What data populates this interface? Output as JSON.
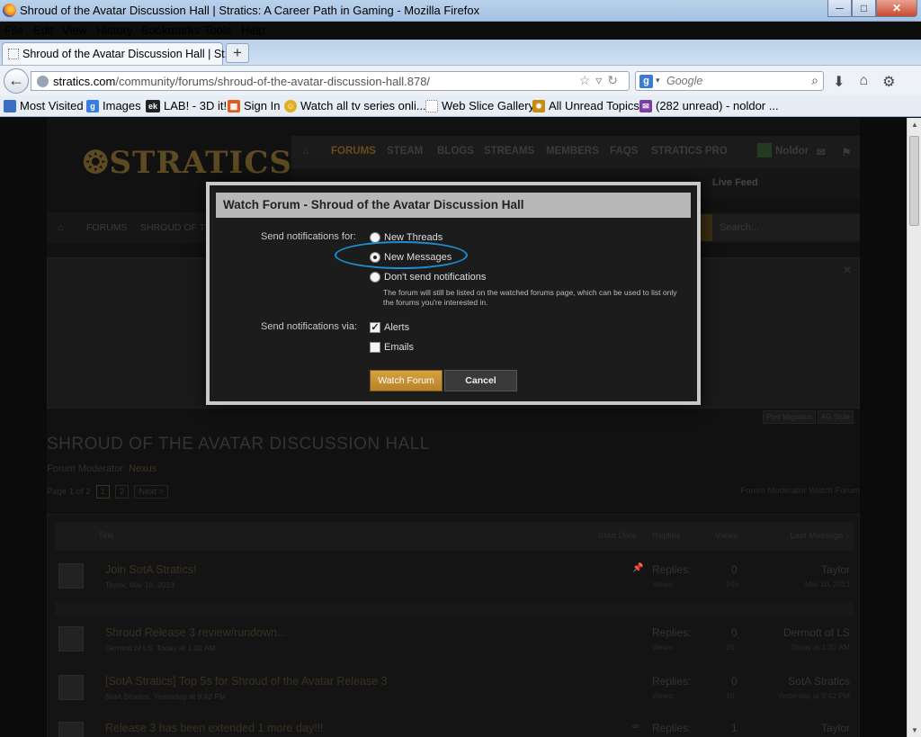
{
  "window": {
    "title": "Shroud of the Avatar Discussion Hall | Stratics: A Career Path in Gaming - Mozilla Firefox",
    "min": "─",
    "max": "□",
    "close": "✕"
  },
  "menu": [
    "File",
    "Edit",
    "View",
    "History",
    "Bookmarks",
    "Tools",
    "Help"
  ],
  "tab": {
    "title": "Shroud of the Avatar Discussion Hall | St...",
    "new_tab": "+"
  },
  "nav": {
    "back": "←",
    "url_host": "stratics.com",
    "url_path": "/community/forums/shroud-of-the-avatar-discussion-hall.878/",
    "url_tools": "☆▿↻",
    "search_placeholder": "Google",
    "search_engine_icon": "g-icon",
    "icons": [
      "⬇",
      "⌂",
      "⚙"
    ]
  },
  "bookmarks": [
    {
      "label": "Most Visited",
      "icon": "M",
      "color": "#3a6fc4"
    },
    {
      "label": "Images",
      "icon": "g",
      "color": "#3a7de0"
    },
    {
      "label": "LAB! - 3D it!",
      "icon": "ek",
      "color": "#222"
    },
    {
      "label": "Sign In",
      "icon": "▦",
      "color": "#e25a1c"
    },
    {
      "label": "Watch all tv series onli...",
      "icon": "☺",
      "color": "#e0b020"
    },
    {
      "label": "Web Slice Gallery",
      "icon": "",
      "color": "#ffffff"
    },
    {
      "label": "All Unread Topics",
      "icon": "✸",
      "color": "#c88a10"
    },
    {
      "label": "(282 unread) - noldor ...",
      "icon": "✉",
      "color": "#7a3fa0"
    }
  ],
  "site": {
    "logo": "❂STRATICS",
    "topnav": [
      "⌂",
      "FORUMS",
      "STEAM",
      "BLOGS",
      "STREAMS",
      "MEMBERS",
      "FAQS",
      "STRATICS PRO"
    ],
    "user": "Noldor",
    "live_feed": "Live Feed",
    "crumbs": [
      "⌂",
      "FORUMS",
      "SHROUD OF THE"
    ],
    "search_placeholder": "Search...",
    "style_tabs": [
      "Post Migration",
      "AG Style"
    ],
    "forum_title": "SHROUD OF THE AVATAR DISCUSSION HALL",
    "moderator_label": "Forum Moderator:",
    "moderator_name": "Nexus",
    "page_info": "Page 1 of 2",
    "pages": [
      "1",
      "2",
      "Next >"
    ],
    "right_links": "Forum Moderator   Watch Forum",
    "columns": {
      "title": "Title",
      "start": "Start Date",
      "replies": "Replies",
      "views": "Views",
      "last": "Last Message ↓"
    },
    "threads": [
      {
        "title": "Join SotA Stratics!",
        "meta": "Taylor, Mar 10, 2013",
        "replies_label": "Replies:",
        "replies": "0",
        "views_label": "Views:",
        "views": "246",
        "last_user": "Taylor",
        "last_date": "Mar 10, 2013",
        "pin": "📌"
      },
      {
        "title": "Shroud Release 3 review/rundown...",
        "meta": "Dermott of LS, Today at 1:31 AM",
        "replies_label": "Replies:",
        "replies": "0",
        "views_label": "Views:",
        "views": "15",
        "last_user": "Dermott of LS",
        "last_date": "Today at 1:31 AM",
        "pin": ""
      },
      {
        "title": "[SotA Stratics] Top 5s for Shroud of the Avatar Release 3",
        "meta": "SotA Stratics, Yesterday at 9:42 PM",
        "replies_label": "Replies:",
        "replies": "0",
        "views_label": "Views:",
        "views": "16",
        "last_user": "SotA Stratics",
        "last_date": "Yesterday at 9:42 PM",
        "pin": ""
      },
      {
        "title": "Release 3 has been extended 1 more day!!!",
        "meta": "",
        "replies_label": "Replies:",
        "replies": "1",
        "views_label": "",
        "views": "",
        "last_user": "Taylor",
        "last_date": "",
        "pin": "∞"
      }
    ]
  },
  "modal": {
    "title": "Watch Forum - Shroud of the Avatar Discussion Hall",
    "notify_for_label": "Send notifications for:",
    "options": [
      "New Threads",
      "New Messages",
      "Don't send notifications"
    ],
    "selected": "New Messages",
    "explain": "The forum will still be listed on the watched forums page, which can be used to list only the forums you're interested in.",
    "notify_via_label": "Send notifications via:",
    "via": [
      {
        "label": "Alerts",
        "checked": true
      },
      {
        "label": "Emails",
        "checked": false
      }
    ],
    "check_mark": "✓",
    "watch_button": "Watch Forum",
    "cancel_button": "Cancel",
    "highlight_color": "#1d8ed0"
  }
}
